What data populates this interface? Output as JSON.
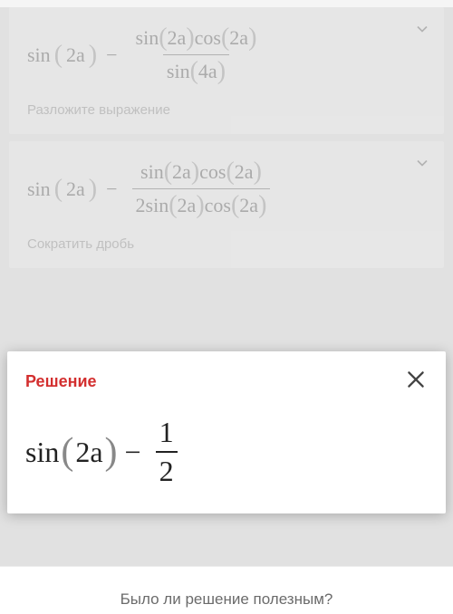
{
  "steps": [
    {
      "lhs": "sin",
      "arg_lhs": "2a",
      "num_a": "sin",
      "num_a_arg": "2a",
      "num_b": "cos",
      "num_b_arg": "2a",
      "den_a": "sin",
      "den_a_arg": "4a",
      "hint": "Разложите выражение"
    },
    {
      "lhs": "sin",
      "arg_lhs": "2a",
      "num_a": "sin",
      "num_a_arg": "2a",
      "num_b": "cos",
      "num_b_arg": "2a",
      "den_prefix": "2",
      "den_a": "sin",
      "den_a_arg": "2a",
      "den_b": "cos",
      "den_b_arg": "2a",
      "hint": "Сократить дробь"
    }
  ],
  "solution": {
    "title": "Решение",
    "lhs": "sin",
    "arg_lhs": "2a",
    "frac_num": "1",
    "frac_den": "2"
  },
  "feedback_prompt": "Было ли решение полезным?"
}
